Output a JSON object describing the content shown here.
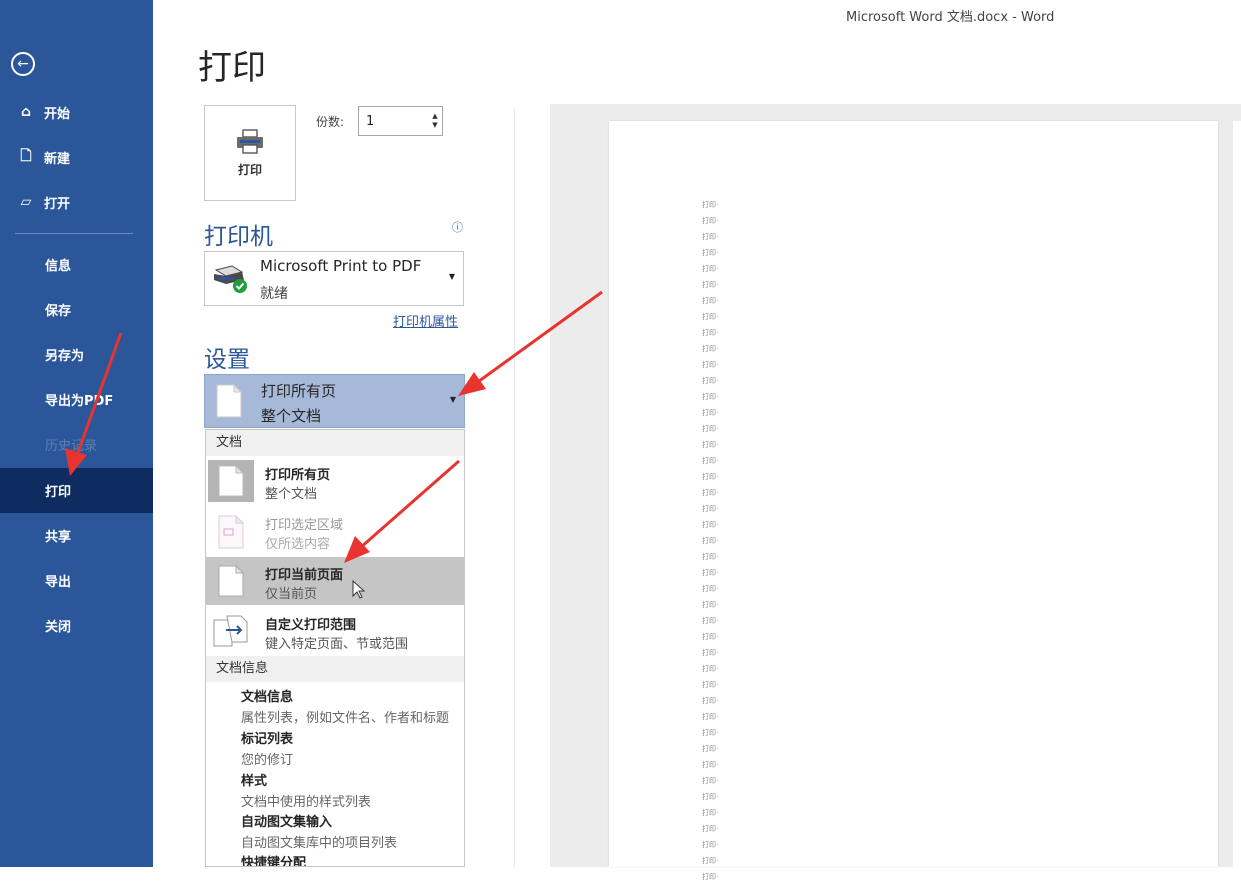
{
  "window": {
    "title": "Microsoft Word 文档.docx  -  Word"
  },
  "sidebar": {
    "back_icon": "back-arrow-icon",
    "items": [
      {
        "label": "开始",
        "icon": "home-icon"
      },
      {
        "label": "新建",
        "icon": "new-document-icon"
      },
      {
        "label": "打开",
        "icon": "open-folder-icon"
      },
      {
        "label": "信息"
      },
      {
        "label": "保存"
      },
      {
        "label": "另存为"
      },
      {
        "label": "导出为PDF"
      },
      {
        "label": "历史记录",
        "state": "disabled"
      },
      {
        "label": "打印",
        "state": "active"
      },
      {
        "label": "共享"
      },
      {
        "label": "导出"
      },
      {
        "label": "关闭"
      }
    ]
  },
  "print": {
    "title": "打印",
    "print_button": "打印",
    "copies_label": "份数:",
    "copies_value": "1",
    "printer_section": "打印机",
    "printer_name": "Microsoft Print to PDF",
    "printer_status": "就绪",
    "printer_properties": "打印机属性",
    "settings_section": "设置",
    "range_selected_title": "打印所有页",
    "range_selected_desc": "整个文档"
  },
  "menu": {
    "header_document": "文档",
    "options": [
      {
        "title": "打印所有页",
        "desc": "整个文档",
        "state": "selected"
      },
      {
        "title": "打印选定区域",
        "desc": "仅所选内容",
        "state": "disabled"
      },
      {
        "title": "打印当前页面",
        "desc": "仅当前页",
        "state": "hovered"
      },
      {
        "title": "自定义打印范围",
        "desc": "键入特定页面、节或范围"
      }
    ],
    "header_docinfo": "文档信息",
    "doc_info": [
      {
        "title": "文档信息",
        "desc": "属性列表，例如文件名、作者和标题"
      },
      {
        "title": "标记列表",
        "desc": "您的修订"
      },
      {
        "title": "样式",
        "desc": "文档中使用的样式列表"
      },
      {
        "title": "自动图文集输入",
        "desc": "自动图文集库中的项目列表"
      },
      {
        "title": "快捷键分配",
        "desc": ""
      }
    ]
  },
  "preview": {
    "line_text": "打印",
    "line_count": 43
  },
  "colors": {
    "accent": "#2b579a",
    "active_nav": "#0f2c61",
    "arrow": "#e8332f"
  }
}
